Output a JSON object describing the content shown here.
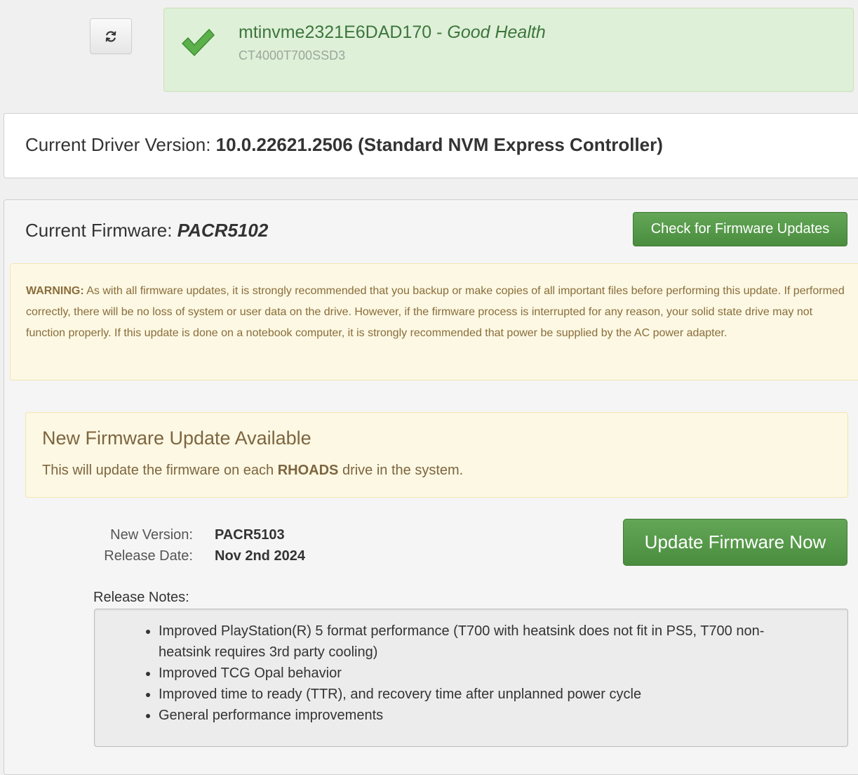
{
  "drive": {
    "name": "mtinvme2321E6DAD170",
    "separator": " - ",
    "health": "Good Health",
    "model": "CT4000T700SSD3"
  },
  "driver": {
    "label": "Current Driver Version: ",
    "version": "10.0.22621.2506 (Standard NVM Express Controller)"
  },
  "firmware": {
    "label": "Current Firmware: ",
    "current": "PACR5102",
    "check_button": "Check for Firmware Updates",
    "warning": {
      "prefix": "WARNING:",
      "text": " As with all firmware updates, it is strongly recommended that you backup or make copies of all important files before performing this update. If performed correctly, there will be no loss of system or user data on the drive. However, if the firmware process is interrupted for any reason, your solid state drive may not function properly. If this update is done on a notebook computer, it is strongly recommended that power be supplied by the AC power adapter."
    },
    "update": {
      "title": "New Firmware Update Available",
      "desc_before": "This will update the firmware on each ",
      "desc_bold": "RHOADS",
      "desc_after": " drive in the system.",
      "new_version_label": "New Version:",
      "new_version": "PACR5103",
      "release_date_label": "Release Date:",
      "release_date": "Nov 2nd 2024",
      "update_button": "Update Firmware Now",
      "notes_label": "Release Notes:",
      "notes": [
        "Improved PlayStation(R) 5 format performance (T700 with heatsink does not fit in PS5, T700 non-heatsink requires 3rd party cooling)",
        "Improved TCG Opal behavior",
        "Improved time to ready (TTR), and recovery time after unplanned power cycle",
        "General performance improvements"
      ]
    }
  },
  "colors": {
    "success_bg": "#dff0d8",
    "success_text": "#3c763d",
    "warning_bg": "#fcf8e3",
    "warning_text": "#8a6d3b",
    "button_green": "#4b8d3f"
  },
  "icons": {
    "refresh": "refresh-icon",
    "health": "check-icon"
  }
}
